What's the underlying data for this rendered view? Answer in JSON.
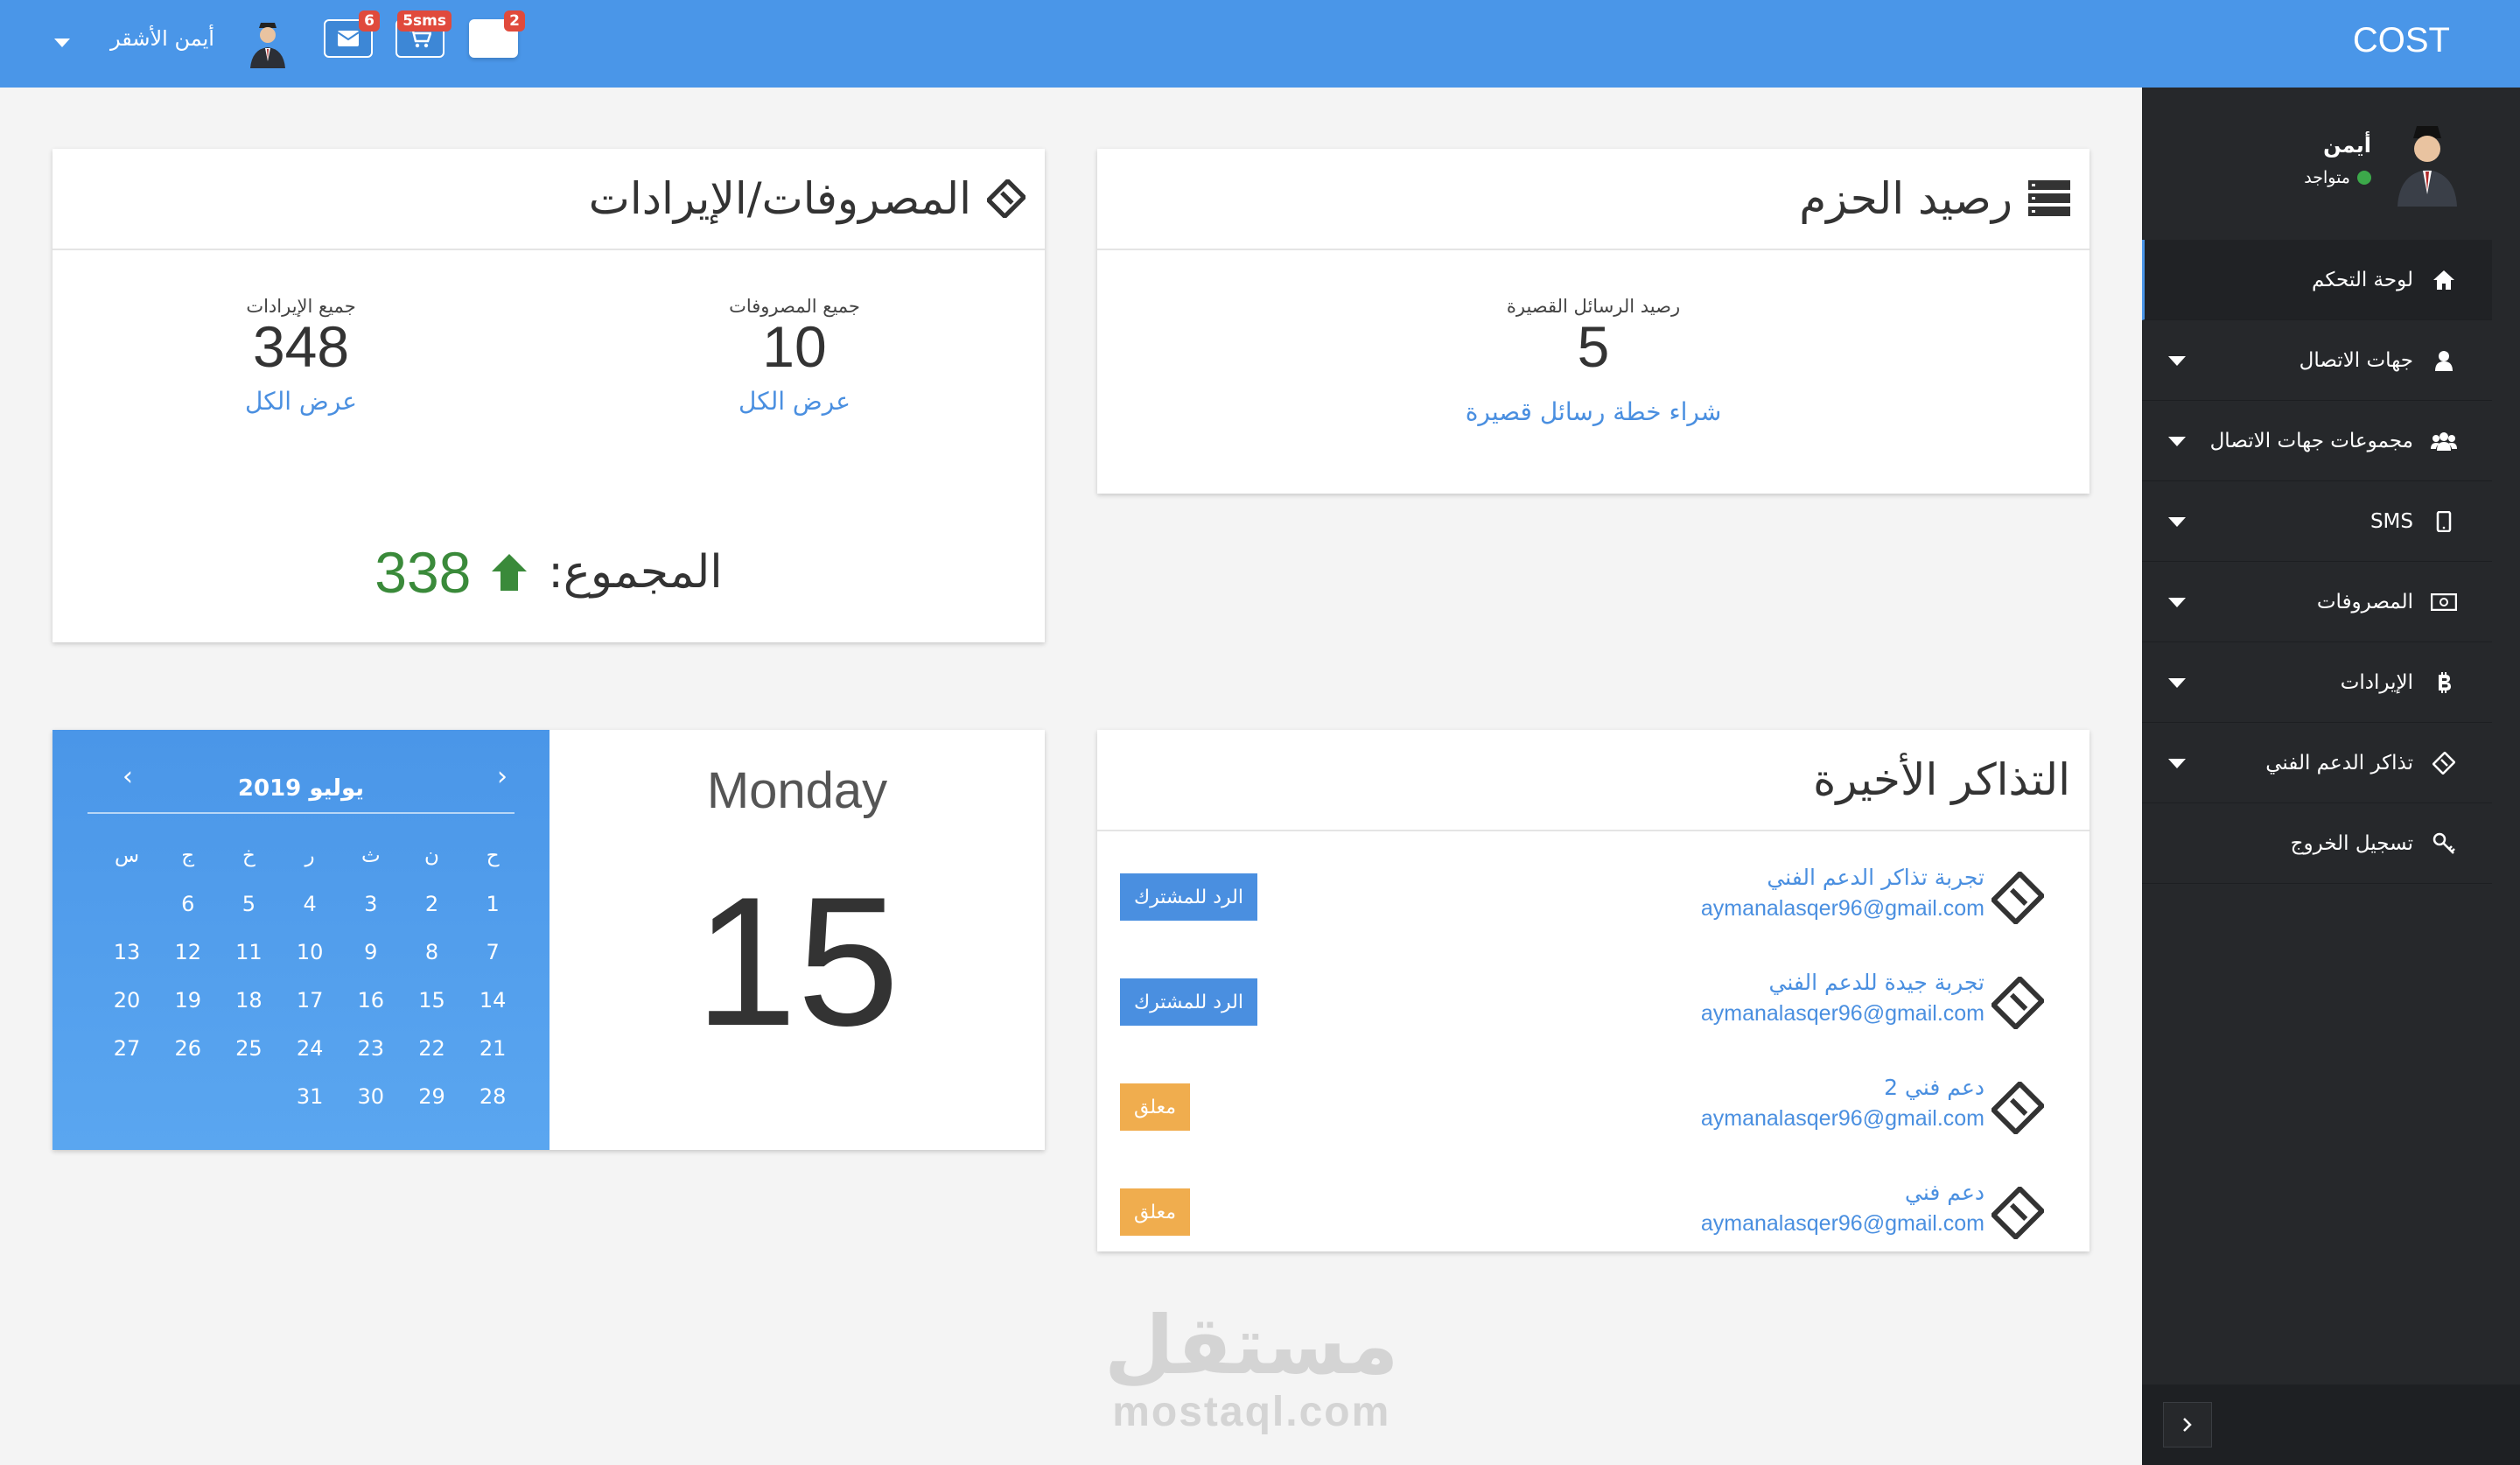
{
  "header": {
    "brand": "COST",
    "user_name": "أيمن الأشقر",
    "badges": {
      "mail": "6",
      "cart": "5sms",
      "card": "2"
    }
  },
  "sidebar": {
    "profile_name": "أيمن",
    "profile_status": "متواجد",
    "items": [
      {
        "label": "لوحة التحكم",
        "icon": "home-icon"
      },
      {
        "label": "جهات الاتصال",
        "icon": "user-icon"
      },
      {
        "label": "مجموعات جهات الاتصال",
        "icon": "users-icon"
      },
      {
        "label": "SMS",
        "icon": "tablet-icon"
      },
      {
        "label": "المصروفات",
        "icon": "money-icon"
      },
      {
        "label": "الإيرادات",
        "icon": "bitcoin-icon"
      },
      {
        "label": "تذاكر الدعم الفني",
        "icon": "ticket-icon"
      },
      {
        "label": "تسجيل الخروج",
        "icon": "key-icon"
      }
    ]
  },
  "balance_card": {
    "title": "رصيد الحزم",
    "sms_label": "رصيد الرسائل القصيرة",
    "sms_value": "5",
    "buy_link": "شراء خطة رسائل قصيرة"
  },
  "finance_card": {
    "title": "المصروفات/الإيرادات",
    "expenses_label": "جميع المصروفات",
    "expenses_value": "10",
    "expenses_link": "عرض الكل",
    "income_label": "جميع الإيرادات",
    "income_value": "348",
    "income_link": "عرض الكل",
    "total_label": "المجموع:",
    "total_value": "338"
  },
  "tickets_card": {
    "title": "التذاكر الأخيرة",
    "tickets": [
      {
        "title": "تجربة تذاكر الدعم الفني",
        "email": "aymanalasqer96@gmail.com",
        "status": "الرد للمشترك",
        "status_color": "#4a8fe0"
      },
      {
        "title": "تجربة جيدة للدعم الفني",
        "email": "aymanalasqer96@gmail.com",
        "status": "الرد للمشترك",
        "status_color": "#4a8fe0"
      },
      {
        "title": "دعم فني 2",
        "email": "aymanalasqer96@gmail.com",
        "status": "معلق",
        "status_color": "#f0ad4e"
      },
      {
        "title": "دعم فني",
        "email": "aymanalasqer96@gmail.com",
        "status": "معلق",
        "status_color": "#f0ad4e"
      }
    ]
  },
  "calendar": {
    "month_label": "يوليو 2019",
    "weekdays": [
      "ح",
      "ن",
      "ث",
      "ر",
      "خ",
      "ج",
      "س"
    ],
    "weeks": [
      [
        "1",
        "2",
        "3",
        "4",
        "5",
        "6",
        ""
      ],
      [
        "7",
        "8",
        "9",
        "10",
        "11",
        "12",
        "13"
      ],
      [
        "14",
        "15",
        "16",
        "17",
        "18",
        "19",
        "20"
      ],
      [
        "21",
        "22",
        "23",
        "24",
        "25",
        "26",
        "27"
      ],
      [
        "28",
        "29",
        "30",
        "31",
        "",
        "",
        ""
      ]
    ],
    "day_name": "Monday",
    "day_number": "15"
  },
  "watermark": {
    "arabic": "مستقل",
    "latin": "mostaql.com"
  },
  "colors": {
    "header": "#4a96e8",
    "sidebar": "#26282b",
    "link": "#4a8fe0",
    "positive": "#3a8a3a",
    "pending": "#f0ad4e"
  }
}
